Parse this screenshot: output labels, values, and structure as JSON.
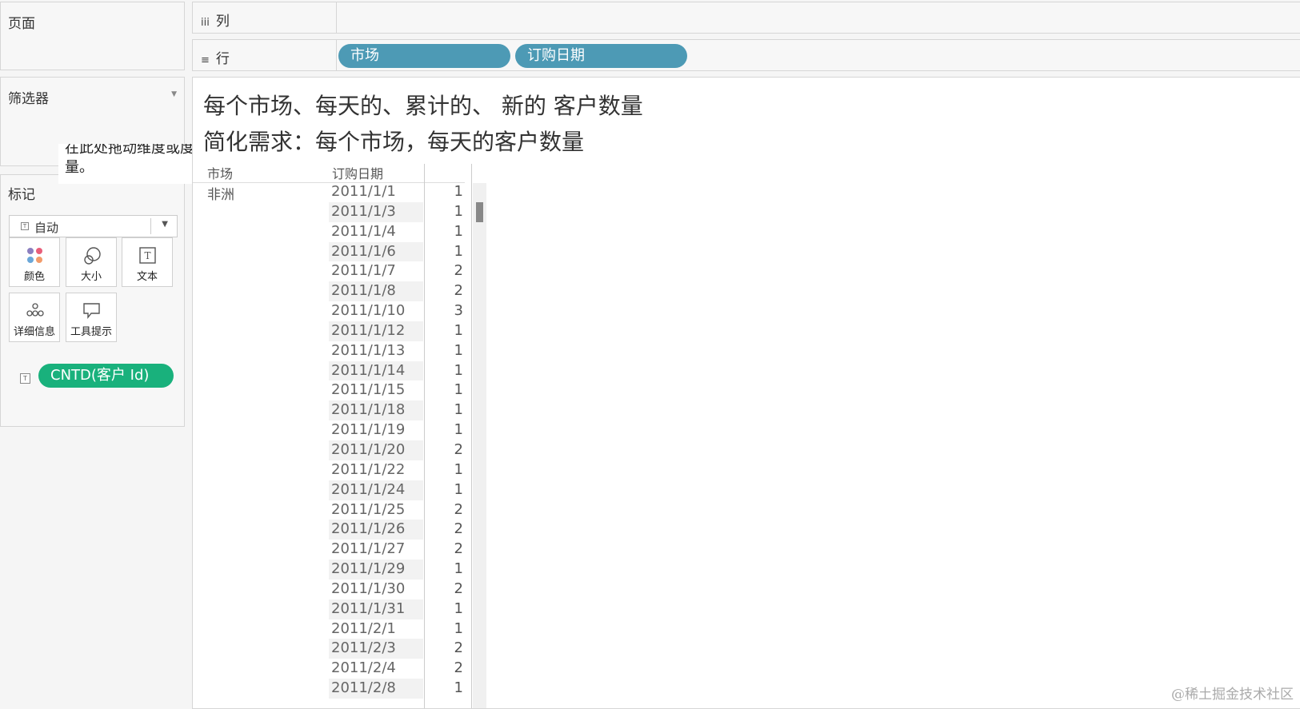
{
  "left_panels": {
    "pages_title": "页面",
    "filters_title": "筛选器",
    "marks_title": "标记",
    "drop_hint": "在此处拖动维度或度量。",
    "mark_type": "自动",
    "mark_buttons": [
      {
        "label": "颜色",
        "icon": "color-icon"
      },
      {
        "label": "大小",
        "icon": "size-icon"
      },
      {
        "label": "文本",
        "icon": "text-icon"
      },
      {
        "label": "详细信息",
        "icon": "detail-icon"
      },
      {
        "label": "工具提示",
        "icon": "tooltip-icon"
      }
    ],
    "measure_pill": "CNTD(客户 Id)"
  },
  "shelves": {
    "columns_icon": "iii",
    "columns_label": "列",
    "rows_icon": "≡",
    "rows_label": "行",
    "row_pills": [
      "市场",
      "订购日期"
    ]
  },
  "view": {
    "title_line1": "每个市场、每天的、累计的、 新的 客户数量",
    "title_line2": "简化需求：每个市场，每天的客户数量",
    "header_market": "市场",
    "header_date": "订购日期",
    "market_value": "非洲",
    "rows": [
      {
        "date": "2011/1/1",
        "value": "1"
      },
      {
        "date": "2011/1/3",
        "value": "1"
      },
      {
        "date": "2011/1/4",
        "value": "1"
      },
      {
        "date": "2011/1/6",
        "value": "1"
      },
      {
        "date": "2011/1/7",
        "value": "2"
      },
      {
        "date": "2011/1/8",
        "value": "2"
      },
      {
        "date": "2011/1/10",
        "value": "3"
      },
      {
        "date": "2011/1/12",
        "value": "1"
      },
      {
        "date": "2011/1/13",
        "value": "1"
      },
      {
        "date": "2011/1/14",
        "value": "1"
      },
      {
        "date": "2011/1/15",
        "value": "1"
      },
      {
        "date": "2011/1/18",
        "value": "1"
      },
      {
        "date": "2011/1/19",
        "value": "1"
      },
      {
        "date": "2011/1/20",
        "value": "2"
      },
      {
        "date": "2011/1/22",
        "value": "1"
      },
      {
        "date": "2011/1/24",
        "value": "1"
      },
      {
        "date": "2011/1/25",
        "value": "2"
      },
      {
        "date": "2011/1/26",
        "value": "2"
      },
      {
        "date": "2011/1/27",
        "value": "2"
      },
      {
        "date": "2011/1/29",
        "value": "1"
      },
      {
        "date": "2011/1/30",
        "value": "2"
      },
      {
        "date": "2011/1/31",
        "value": "1"
      },
      {
        "date": "2011/2/1",
        "value": "1"
      },
      {
        "date": "2011/2/3",
        "value": "2"
      },
      {
        "date": "2011/2/4",
        "value": "2"
      },
      {
        "date": "2011/2/8",
        "value": "1"
      }
    ]
  },
  "watermark": "@稀土掘金技术社区",
  "colors": {
    "dimension_pill": "#4d9ab5",
    "measure_pill": "#19b17c"
  }
}
